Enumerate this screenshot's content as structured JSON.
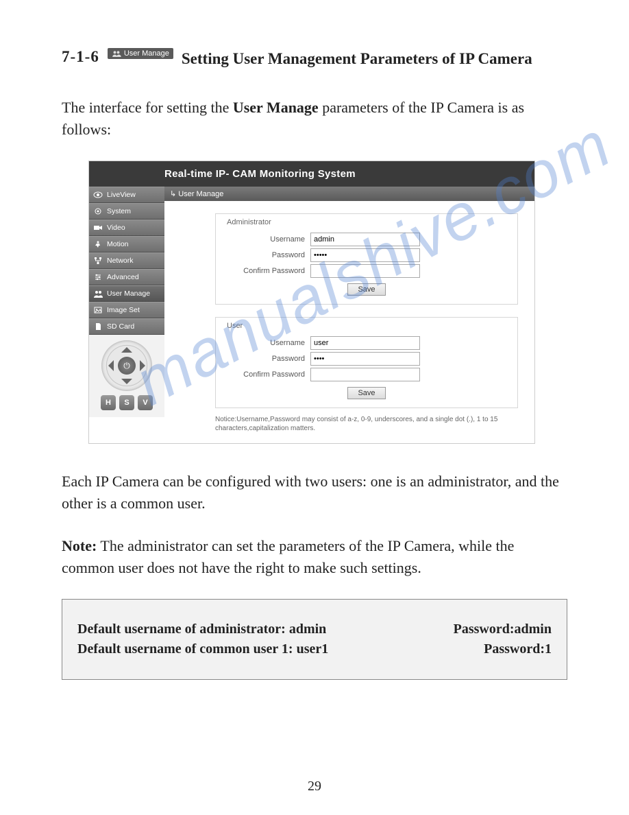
{
  "section": {
    "number": "7-1-6",
    "chip_label": "User Manage",
    "title": "Setting User Management Parameters of IP Camera"
  },
  "intro": {
    "pre": "The interface for setting the ",
    "bold": "User Manage",
    "post": " parameters of the IP Camera is as follows:"
  },
  "screenshot": {
    "header": "Real-time IP- CAM Monitoring System",
    "breadcrumb": "↳ User Manage",
    "sidebar": [
      {
        "label": "LiveView",
        "icon": "eye"
      },
      {
        "label": "System",
        "icon": "gear"
      },
      {
        "label": "Video",
        "icon": "camera"
      },
      {
        "label": "Motion",
        "icon": "motion"
      },
      {
        "label": "Network",
        "icon": "network"
      },
      {
        "label": "Advanced",
        "icon": "sliders"
      },
      {
        "label": "User Manage",
        "icon": "users",
        "selected": true
      },
      {
        "label": "Image Set",
        "icon": "image"
      },
      {
        "label": "SD Card",
        "icon": "sdcard"
      }
    ],
    "hsv": [
      "H",
      "S",
      "V"
    ],
    "admin_panel": {
      "legend": "Administrator",
      "username_label": "Username",
      "username_value": "admin",
      "password_label": "Password",
      "password_value": "•••••",
      "confirm_label": "Confirm Password",
      "confirm_value": "",
      "save": "Save"
    },
    "user_panel": {
      "legend": "User",
      "username_label": "Username",
      "username_value": "user",
      "password_label": "Password",
      "password_value": "••••",
      "confirm_label": "Confirm Password",
      "confirm_value": "",
      "save": "Save"
    },
    "notice": "Notice:Username,Password may consist of a-z, 0-9, underscores, and a single dot (.), 1 to 15 characters,capitalization matters."
  },
  "para2": "Each IP Camera can be configured with two users: one is an administrator, and the other is a common user.",
  "note": {
    "label": "Note:",
    "text": " The administrator can set the parameters of the IP Camera, while the common user does not have the right to make such settings."
  },
  "defaults": {
    "line1_left": "Default username of administrator: admin",
    "line1_right": "Password:admin",
    "line2_left": "Default username of common user 1: user1",
    "line2_right": "Password:1"
  },
  "watermark": "manualshive.com",
  "page_number": "29"
}
